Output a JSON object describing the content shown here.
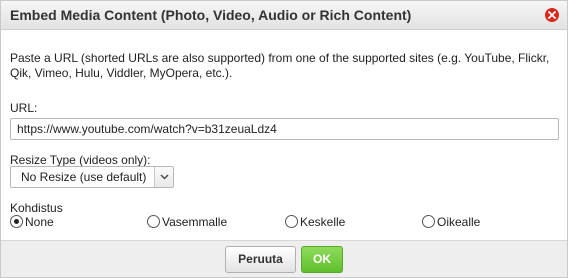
{
  "dialog": {
    "title": "Embed Media Content (Photo, Video, Audio or Rich Content)",
    "close_icon": "close-icon",
    "accent_color": "#d8291f"
  },
  "intro": {
    "text": "Paste a URL (shorted URLs are also supported) from one of the supported sites (e.g. YouTube, Flickr, Qik, Vimeo, Hulu, Viddler, MyOpera, etc.)."
  },
  "url": {
    "label": "URL:",
    "value": "https://www.youtube.com/watch?v=b31zeuaLdz4"
  },
  "resize": {
    "label": "Resize Type (videos only):",
    "selected": "No Resize (use default)"
  },
  "align": {
    "label": "Kohdistus",
    "options": [
      {
        "label": "None",
        "checked": true
      },
      {
        "label": "Vasemmalle",
        "checked": false
      },
      {
        "label": "Keskelle",
        "checked": false
      },
      {
        "label": "Oikealle",
        "checked": false
      }
    ]
  },
  "footer": {
    "cancel_label": "Peruuta",
    "ok_label": "OK",
    "ok_color": "#5fbf2c"
  }
}
